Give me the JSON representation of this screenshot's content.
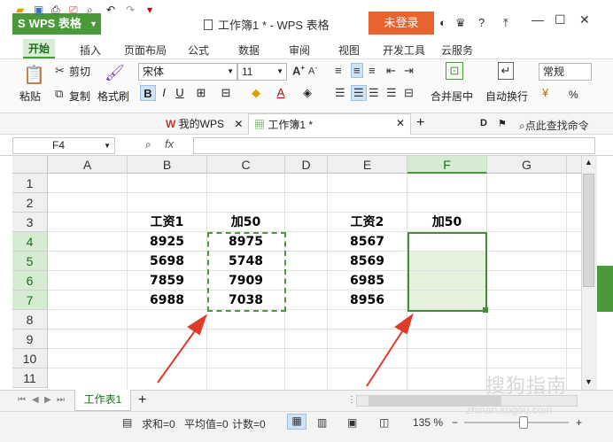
{
  "titlebar": {
    "app_button": "WPS 表格",
    "doc_title": "工作簿1 * - WPS 表格",
    "login": "未登录",
    "help": "?"
  },
  "menu_tabs": [
    "开始",
    "插入",
    "页面布局",
    "公式",
    "数据",
    "审阅",
    "视图",
    "开发工具",
    "云服务"
  ],
  "ribbon": {
    "paste": "粘贴",
    "cut": "剪切",
    "copy": "复制",
    "format_painter": "格式刷",
    "font_name": "宋体",
    "font_size": "11",
    "merge_center": "合并居中",
    "wrap_text": "自动换行",
    "number_format": "常规",
    "percent": "%"
  },
  "doc_tabs": {
    "my_wps": "我的WPS",
    "workbook": "工作簿1 *",
    "search_cmd": "点此查找命令"
  },
  "formula_bar": {
    "name_box": "F4",
    "fx": "fx",
    "value": ""
  },
  "columns": [
    "A",
    "B",
    "C",
    "D",
    "E",
    "F",
    "G"
  ],
  "rows": [
    "1",
    "2",
    "3",
    "4",
    "5",
    "6",
    "7",
    "8",
    "9",
    "10",
    "11"
  ],
  "cells": {
    "B3": "工资1",
    "C3": "加50",
    "E3": "工资2",
    "F3": "加50",
    "B4": "8925",
    "C4": "8975",
    "E4": "8567",
    "B5": "5698",
    "C5": "5748",
    "E5": "8569",
    "B6": "7859",
    "C6": "7909",
    "E6": "6985",
    "B7": "6988",
    "C7": "7038",
    "E7": "8956"
  },
  "sheet_tab": "工作表1",
  "statusbar": {
    "sum": "求和=0",
    "average": "平均值=0",
    "count": "计数=0",
    "zoom": "135 %"
  },
  "watermark": "搜狗指南",
  "watermark_url": "zhinan.sogou.com",
  "colors": {
    "brand": "#4a9a3a",
    "login": "#e8632d",
    "arrow": "#e03a2a"
  }
}
